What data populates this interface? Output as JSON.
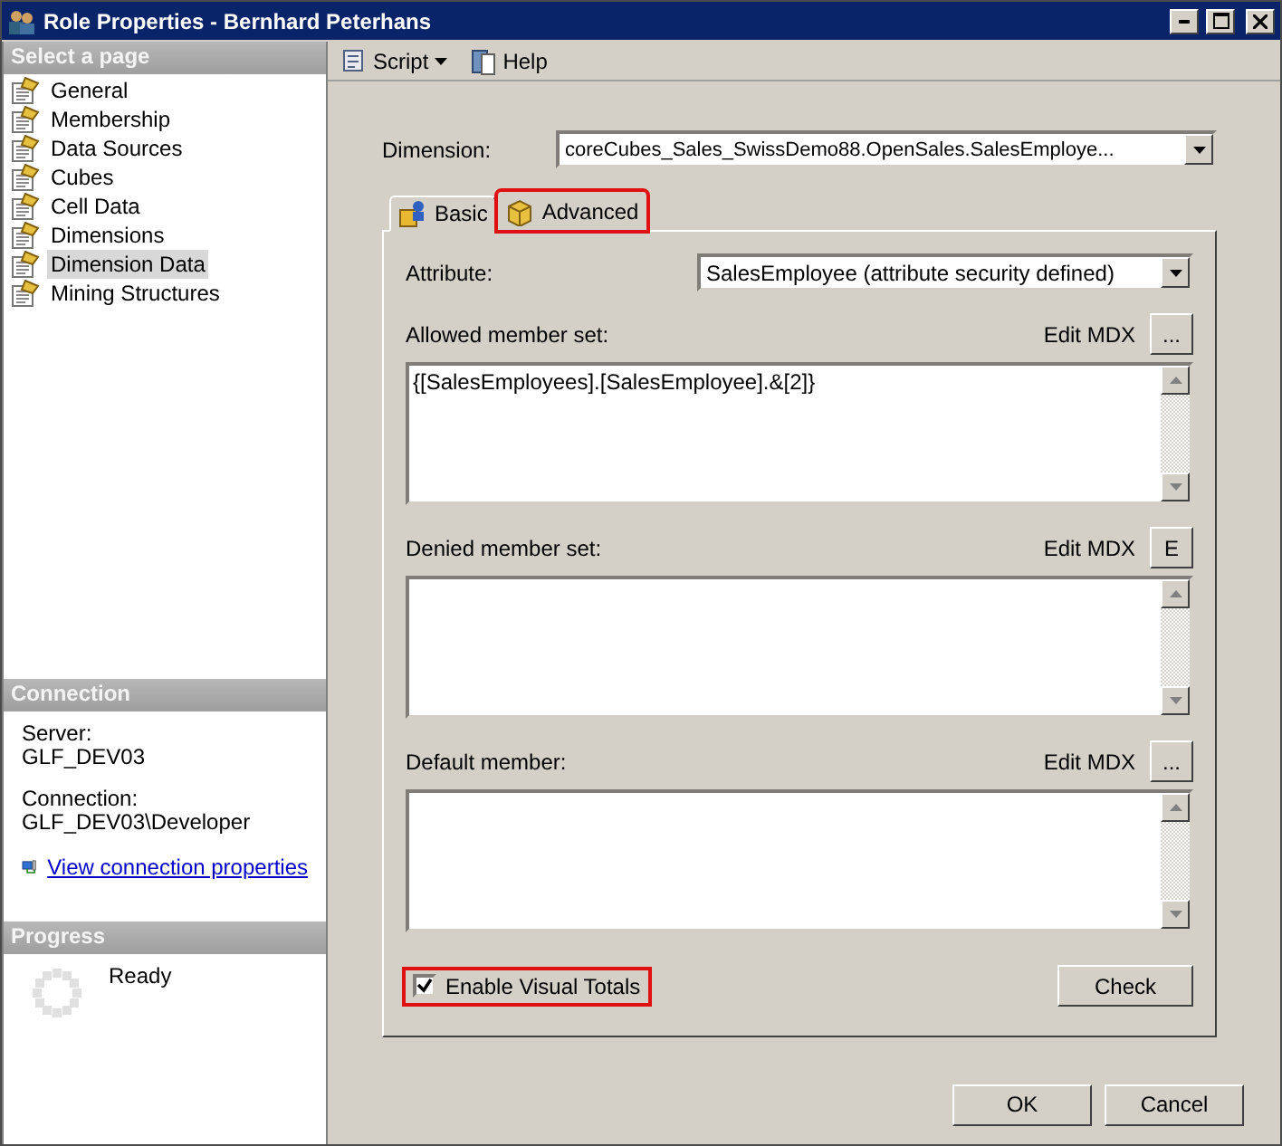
{
  "window": {
    "title": "Role Properties - Bernhard Peterhans"
  },
  "sidebar": {
    "header": "Select a page",
    "items": [
      {
        "label": "General",
        "selected": false
      },
      {
        "label": "Membership",
        "selected": false
      },
      {
        "label": "Data Sources",
        "selected": false
      },
      {
        "label": "Cubes",
        "selected": false
      },
      {
        "label": "Cell Data",
        "selected": false
      },
      {
        "label": "Dimensions",
        "selected": false
      },
      {
        "label": "Dimension Data",
        "selected": true
      },
      {
        "label": "Mining Structures",
        "selected": false
      }
    ]
  },
  "connection": {
    "header": "Connection",
    "server_label": "Server:",
    "server": "GLF_DEV03",
    "connection_label": "Connection:",
    "connection": "GLF_DEV03\\Developer",
    "link": "View connection properties"
  },
  "progress": {
    "header": "Progress",
    "status": "Ready"
  },
  "toolbar": [
    {
      "label": "Script",
      "kind": "dropdown"
    },
    {
      "label": "Help",
      "kind": "plain"
    }
  ],
  "dimension": {
    "label": "Dimension:",
    "value": "coreCubes_Sales_SwissDemo88.OpenSales.SalesEmploye..."
  },
  "tabs": [
    {
      "label": "Basic",
      "selected": false,
      "highlighted": false
    },
    {
      "label": "Advanced",
      "selected": true,
      "highlighted": true
    }
  ],
  "attribute": {
    "label": "Attribute:",
    "value": "SalesEmployee (attribute security defined)"
  },
  "member_sets": [
    {
      "label": "Allowed member set:",
      "button": "Edit MDX",
      "more": "...",
      "value": "{[SalesEmployees].[SalesEmployee].&[2]}"
    },
    {
      "label": "Denied member set:",
      "button": "Edit MDX",
      "more": "E"
    },
    {
      "label": "Default member:",
      "button": "Edit MDX",
      "more": "..."
    }
  ],
  "visual_totals": {
    "label": "Enable Visual Totals",
    "checked": true,
    "highlighted": true
  },
  "check_button": "Check",
  "buttons": [
    "OK",
    "Cancel"
  ]
}
